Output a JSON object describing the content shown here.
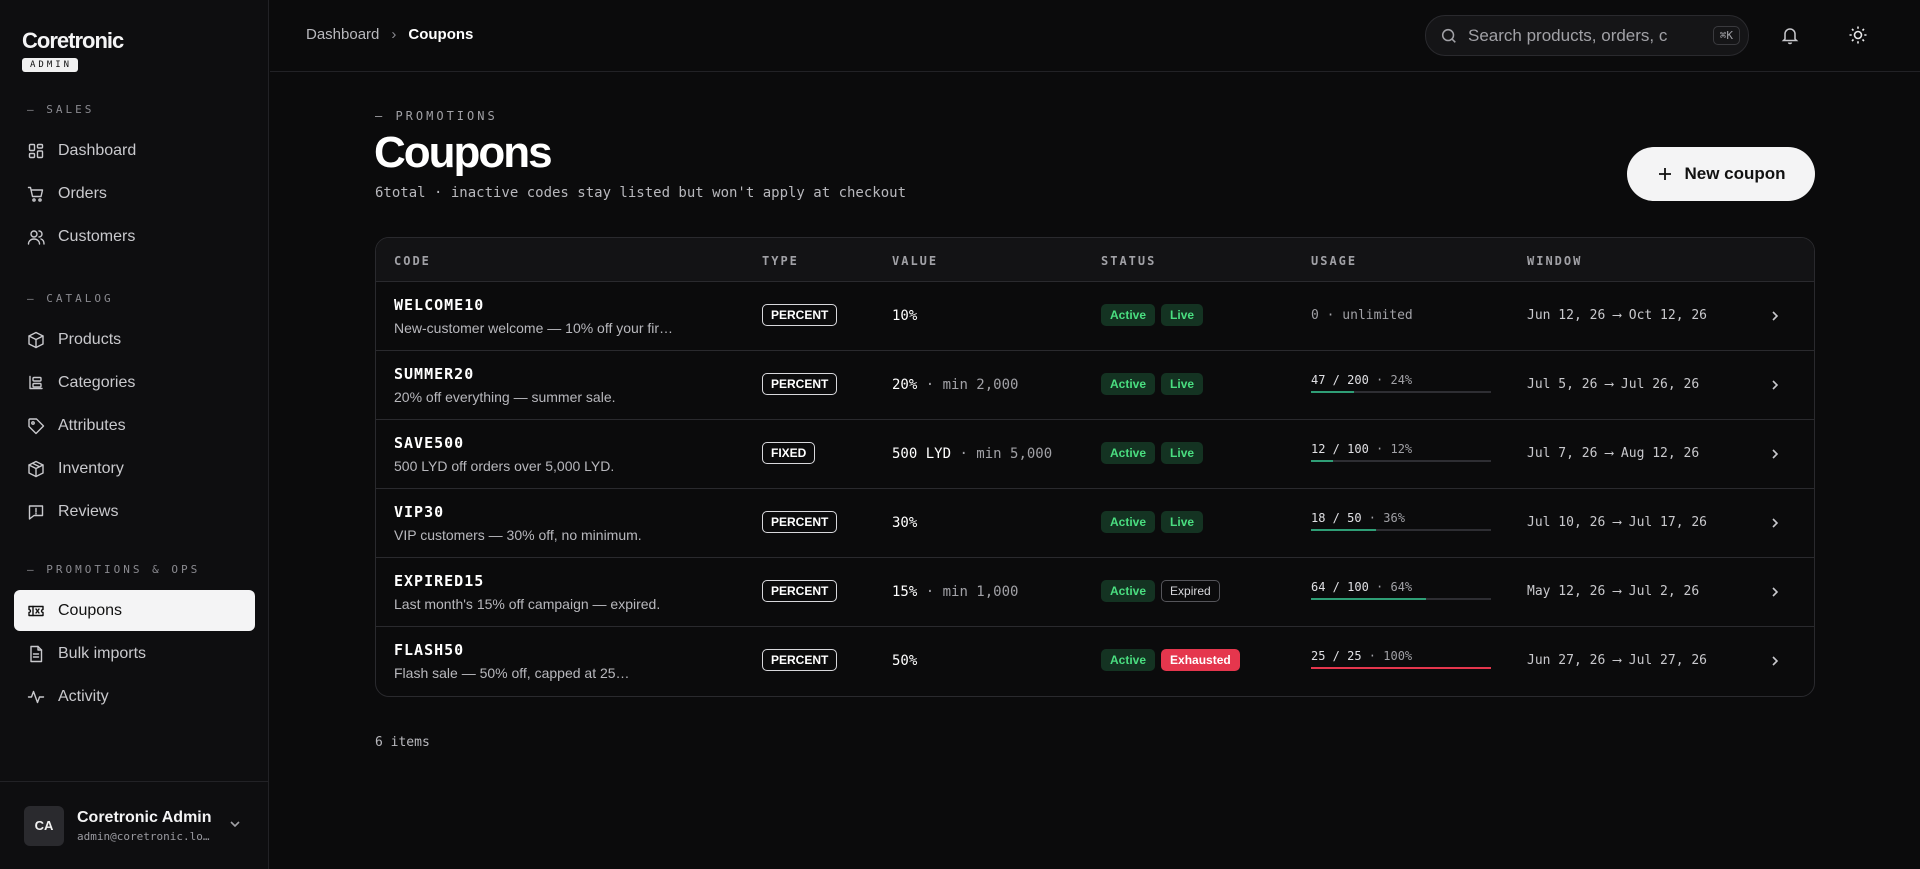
{
  "brand": {
    "name": "Coretronic",
    "badge": "ADMIN"
  },
  "sidebar": {
    "sections": [
      {
        "heading": "— SALES",
        "items": [
          {
            "label": "Dashboard",
            "icon": "dashboard-icon"
          },
          {
            "label": "Orders",
            "icon": "cart-icon"
          },
          {
            "label": "Customers",
            "icon": "users-icon"
          }
        ]
      },
      {
        "heading": "— CATALOG",
        "items": [
          {
            "label": "Products",
            "icon": "box-icon"
          },
          {
            "label": "Categories",
            "icon": "categories-icon"
          },
          {
            "label": "Attributes",
            "icon": "tag-icon"
          },
          {
            "label": "Inventory",
            "icon": "package-icon"
          },
          {
            "label": "Reviews",
            "icon": "review-icon"
          }
        ]
      },
      {
        "heading": "— PROMOTIONS & OPS",
        "items": [
          {
            "label": "Coupons",
            "icon": "ticket-icon",
            "active": true
          },
          {
            "label": "Bulk imports",
            "icon": "file-icon"
          },
          {
            "label": "Activity",
            "icon": "activity-icon"
          }
        ]
      }
    ]
  },
  "user": {
    "initials": "CA",
    "name": "Coretronic Admin",
    "email": "admin@coretronic.lo…"
  },
  "breadcrumb": {
    "parent": "Dashboard",
    "separator": "›",
    "current": "Coupons"
  },
  "search": {
    "placeholder": "Search products, orders, c",
    "shortcut": "⌘K"
  },
  "page": {
    "eyebrow": "— PROMOTIONS",
    "title": "Coupons",
    "subtitle": "6total · inactive codes stay listed but won't apply at checkout",
    "new_button": "New coupon",
    "footer": "6 items"
  },
  "table": {
    "headers": {
      "code": "CODE",
      "type": "TYPE",
      "value": "VALUE",
      "status": "STATUS",
      "usage": "USAGE",
      "window": "WINDOW"
    },
    "rows": [
      {
        "code": "WELCOME10",
        "desc": "New-customer welcome — 10% off your fir…",
        "type": "PERCENT",
        "value": "10%",
        "min": "",
        "status": "Active",
        "state": "Live",
        "state_style": "green",
        "usage_text": "0 · unlimited",
        "usage_pct_label": "",
        "usage_fraction": null,
        "window": "Jun 12, 26 ⟶ Oct 12, 26"
      },
      {
        "code": "SUMMER20",
        "desc": "20% off everything — summer sale.",
        "type": "PERCENT",
        "value": "20%",
        "min": " · min 2,000",
        "status": "Active",
        "state": "Live",
        "state_style": "green",
        "usage_text": "47 / 200",
        "usage_pct_label": " · 24%",
        "usage_fraction": 0.24,
        "window": "Jul 5, 26 ⟶ Jul 26, 26"
      },
      {
        "code": "SAVE500",
        "desc": "500 LYD off orders over 5,000 LYD.",
        "type": "FIXED",
        "value": "500 LYD",
        "min": " · min 5,000",
        "status": "Active",
        "state": "Live",
        "state_style": "green",
        "usage_text": "12 / 100",
        "usage_pct_label": " · 12%",
        "usage_fraction": 0.12,
        "window": "Jul 7, 26 ⟶ Aug 12, 26"
      },
      {
        "code": "VIP30",
        "desc": "VIP customers — 30% off, no minimum.",
        "type": "PERCENT",
        "value": "30%",
        "min": "",
        "status": "Active",
        "state": "Live",
        "state_style": "green",
        "usage_text": "18 / 50",
        "usage_pct_label": " · 36%",
        "usage_fraction": 0.36,
        "window": "Jul 10, 26 ⟶ Jul 17, 26"
      },
      {
        "code": "EXPIRED15",
        "desc": "Last month's 15% off campaign — expired.",
        "type": "PERCENT",
        "value": "15%",
        "min": " · min 1,000",
        "status": "Active",
        "state": "Expired",
        "state_style": "outline",
        "usage_text": "64 / 100",
        "usage_pct_label": " · 64%",
        "usage_fraction": 0.64,
        "window": "May 12, 26 ⟶ Jul 2, 26"
      },
      {
        "code": "FLASH50",
        "desc": "Flash sale — 50% off, capped at 25…",
        "type": "PERCENT",
        "value": "50%",
        "min": "",
        "status": "Active",
        "state": "Exhausted",
        "state_style": "red",
        "usage_text": "25 / 25",
        "usage_pct_label": " · 100%",
        "usage_fraction": 1.0,
        "window": "Jun 27, 26 ⟶ Jul 27, 26"
      }
    ]
  },
  "colors": {
    "background": "#0b0b0c",
    "active_green": "#4ade80",
    "usage_bar": "#2f9e76",
    "exhausted_red": "#e5364d"
  }
}
